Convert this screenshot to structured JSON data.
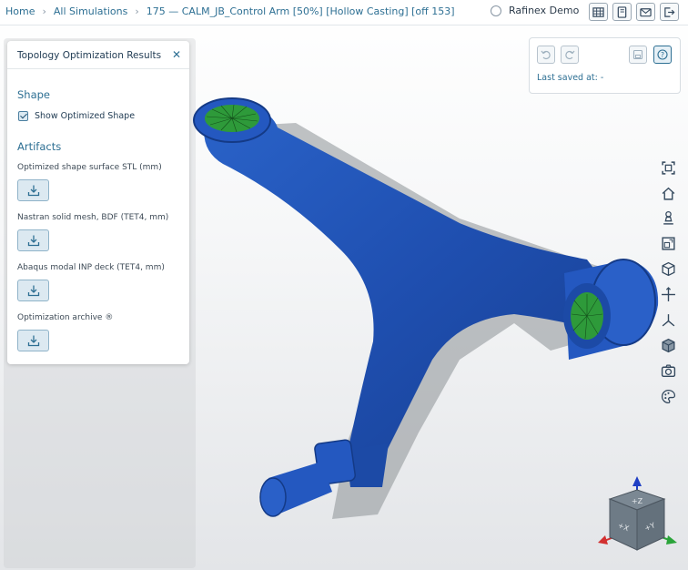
{
  "breadcrumb": {
    "home": "Home",
    "simulations": "All Simulations",
    "current": "175 — CALM_JB_Control Arm [50%] [Hollow Casting] [off 153]"
  },
  "user": {
    "name": "Rafinex Demo",
    "icon": "user-icon"
  },
  "toolbar_icons": [
    "table-icon",
    "notebook-icon",
    "mail-icon",
    "logout-icon"
  ],
  "panel": {
    "title": "Topology Optimization Results",
    "shape_heading": "Shape",
    "show_optimized_label": "Show Optimized Shape",
    "show_optimized_checked": true,
    "artifacts_heading": "Artifacts",
    "artifacts": [
      {
        "label": "Optimized shape surface STL (mm)"
      },
      {
        "label": "Nastran solid mesh, BDF (TET4, mm)"
      },
      {
        "label": "Abaqus modal INP deck (TET4, mm)"
      },
      {
        "label": "Optimization archive ®"
      }
    ]
  },
  "save_panel": {
    "last_saved": "Last saved at: -"
  },
  "view_tools": [
    "fit-view-icon",
    "home-view-icon",
    "probe-icon",
    "zoom-box-icon",
    "cube-view-icon",
    "pan-icon",
    "axes-icon",
    "solid-view-icon",
    "camera-icon",
    "palette-icon"
  ],
  "nav_cube": {
    "top": "+Z",
    "left": "+X",
    "right": "+Y"
  },
  "colors": {
    "accent": "#2d6f93",
    "model": "#1f4fb0",
    "hole": "#2e9a3a"
  }
}
